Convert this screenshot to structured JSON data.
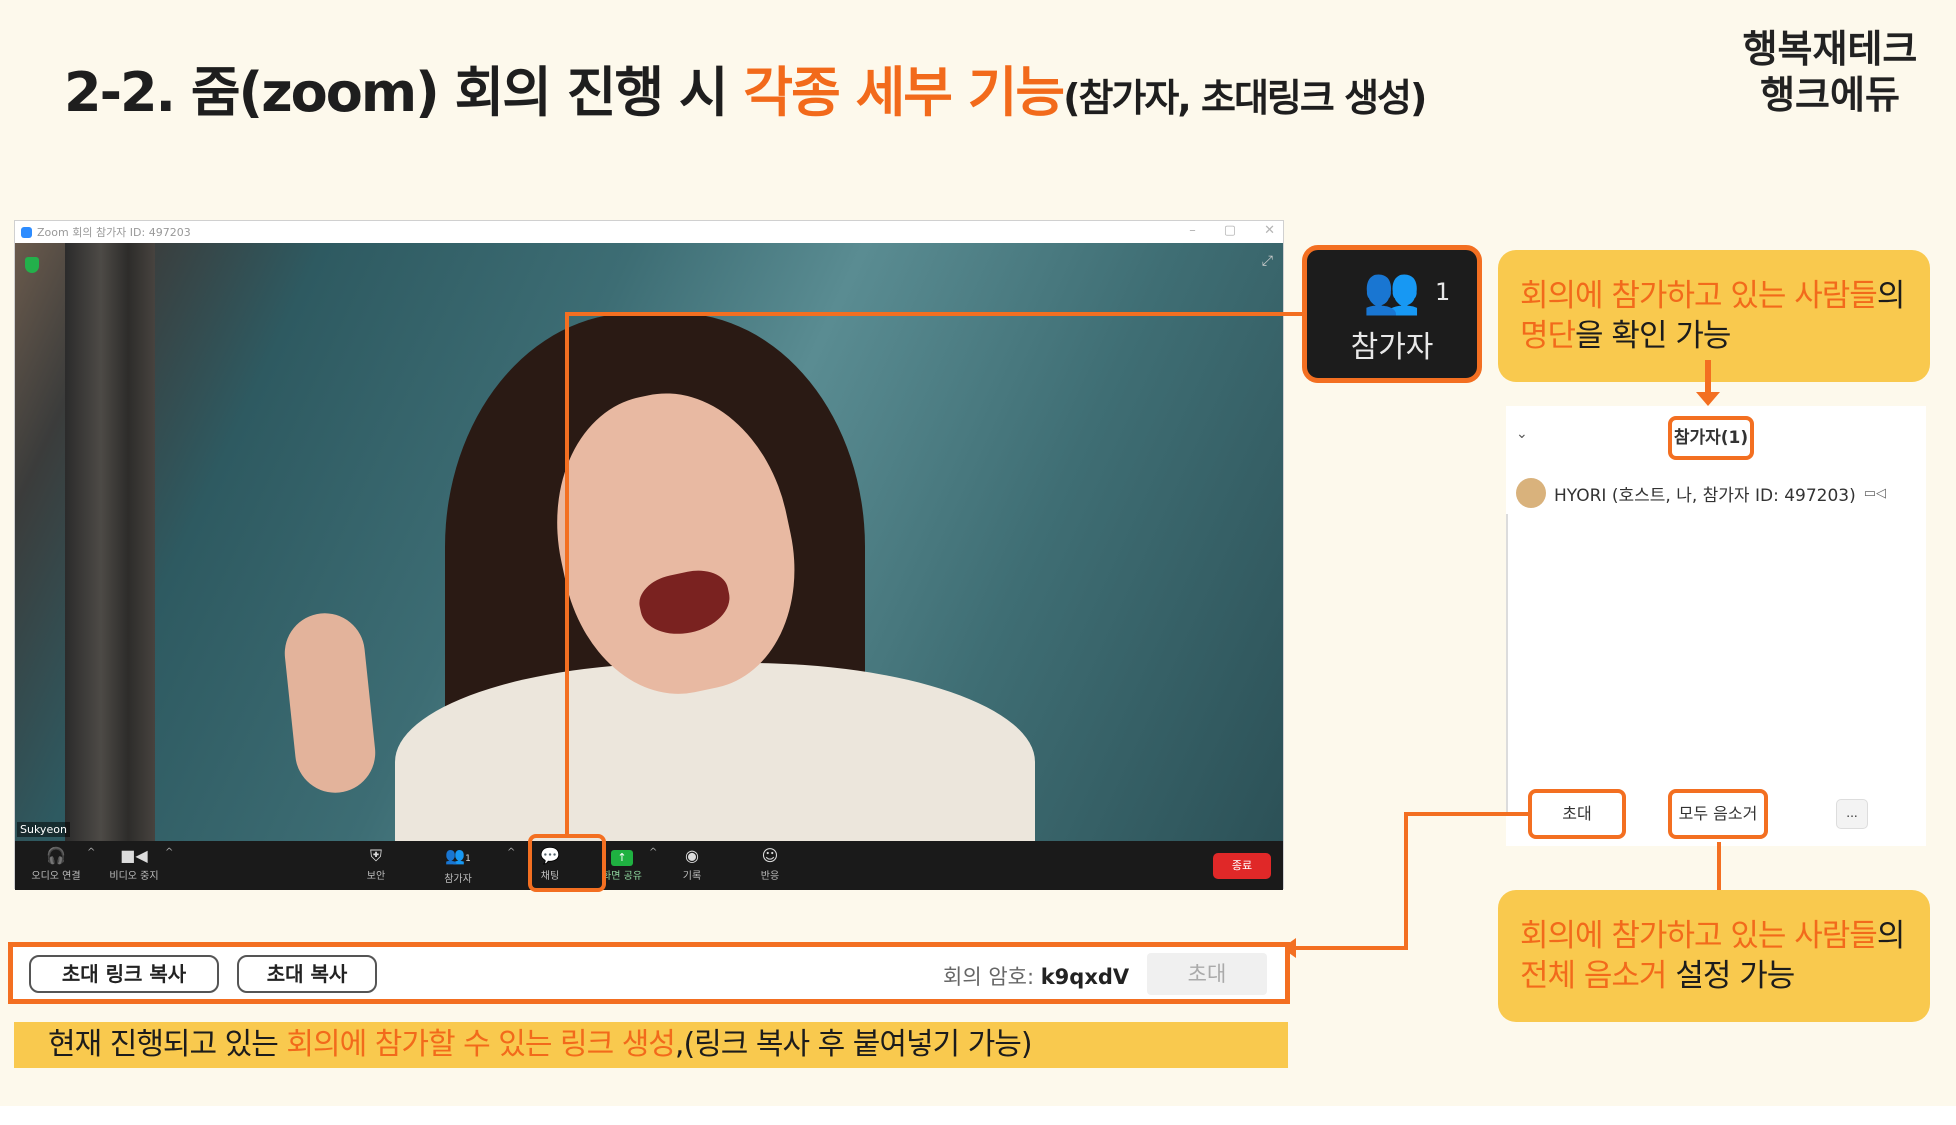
{
  "slide": {
    "title_prefix": "2-2. 줌(zoom) 회의 진행 시 ",
    "title_accent": "각종 세부 기능",
    "title_suffix": "(참가자, 초대링크 생성)",
    "brand_line1": "행복재테크",
    "brand_line2": "행크에듀"
  },
  "zoom": {
    "window_title": "Zoom 회의 참가자 ID: 497203",
    "win_controls": [
      "–",
      "▢",
      "✕"
    ],
    "name_tag": "Sukyeon",
    "toolbar": {
      "audio": "오디오 연결",
      "video": "비디오 중지",
      "security": "보안",
      "participants": "참가자",
      "participants_count": "1",
      "chat": "채팅",
      "share": "화면 공유",
      "record": "기록",
      "reactions": "반응",
      "end": "종료"
    }
  },
  "participant_callout": {
    "count": "1",
    "label": "참가자"
  },
  "notes": {
    "top_accent": "회의에 참가하고 있는 사람들",
    "top_mid": "의",
    "top_accent2": "명단",
    "top_rest": "을 확인 가능",
    "bottom_accent": "회의에 참가하고 있는 사람들",
    "bottom_mid": "의",
    "bottom_accent2": "전체 음소거",
    "bottom_rest": " 설정 가능"
  },
  "panel": {
    "title": "참가자(1)",
    "participant": "HYORI (호스트, 나, 참가자 ID: 497203)",
    "invite_button": "초대",
    "mute_all_button": "모두 음소거",
    "more_button": "..."
  },
  "invite_bar": {
    "copy_link": "초대 링크 복사",
    "copy_invite": "초대 복사",
    "password_label": "회의 암호: ",
    "password_value": "k9qxdV",
    "invite": "초대"
  },
  "caption": {
    "prefix": "현재 진행되고 있는 ",
    "accent": "회의에 참가할 수 있는 링크 생성",
    "suffix": ",(링크 복사 후 붙여넣기 가능)"
  },
  "colors": {
    "accent_orange": "#f26a1b",
    "note_yellow": "#f9c94e",
    "slide_bg": "#fdf9ec",
    "end_red": "#e02828",
    "share_green": "#1fb141"
  }
}
